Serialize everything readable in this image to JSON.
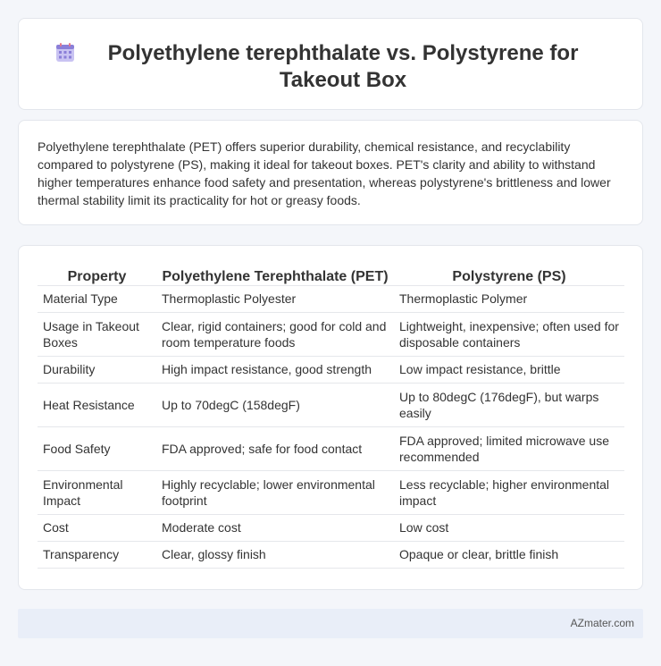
{
  "header": {
    "title": "Polyethylene terephthalate vs. Polystyrene for Takeout Box",
    "icon": "calendar-grid-icon"
  },
  "summary": {
    "text": "Polyethylene terephthalate (PET) offers superior durability, chemical resistance, and recyclability compared to polystyrene (PS), making it ideal for takeout boxes. PET's clarity and ability to withstand higher temperatures enhance food safety and presentation, whereas polystyrene's brittleness and lower thermal stability limit its practicality for hot or greasy foods."
  },
  "table": {
    "columns": [
      "Property",
      "Polyethylene Terephthalate (PET)",
      "Polystyrene (PS)"
    ],
    "rows": [
      [
        "Material Type",
        "Thermoplastic Polyester",
        "Thermoplastic Polymer"
      ],
      [
        "Usage in Takeout Boxes",
        "Clear, rigid containers; good for cold and room temperature foods",
        "Lightweight, inexpensive; often used for disposable containers"
      ],
      [
        "Durability",
        "High impact resistance, good strength",
        "Low impact resistance, brittle"
      ],
      [
        "Heat Resistance",
        "Up to 70degC (158degF)",
        "Up to 80degC (176degF), but warps easily"
      ],
      [
        "Food Safety",
        "FDA approved; safe for food contact",
        "FDA approved; limited microwave use recommended"
      ],
      [
        "Environmental Impact",
        "Highly recyclable; lower environmental footprint",
        "Less recyclable; higher environmental impact"
      ],
      [
        "Cost",
        "Moderate cost",
        "Low cost"
      ],
      [
        "Transparency",
        "Clear, glossy finish",
        "Opaque or clear, brittle finish"
      ]
    ]
  },
  "footer": {
    "brand": "AZmater.com"
  },
  "colors": {
    "icon_primary": "#8b7fd8",
    "icon_header": "#e67a8a",
    "footer_bg": "#e9eef8"
  }
}
